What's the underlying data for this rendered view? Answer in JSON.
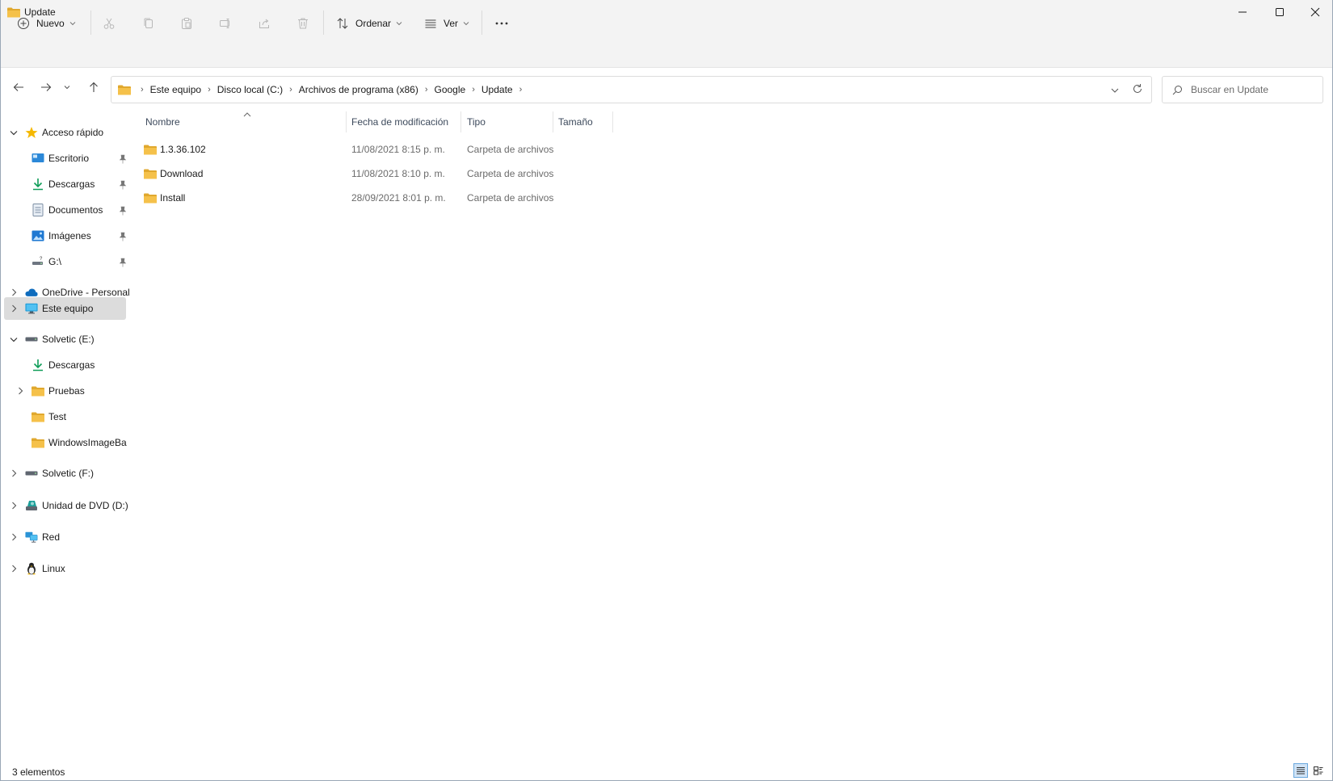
{
  "window": {
    "title": "Update",
    "controls": [
      "minimize",
      "maximize",
      "close"
    ]
  },
  "toolbar": {
    "new_label": "Nuevo",
    "sort_label": "Ordenar",
    "view_label": "Ver",
    "icons": [
      "cut-icon",
      "copy-icon",
      "paste-icon",
      "rename-icon",
      "share-icon",
      "delete-icon"
    ]
  },
  "address": {
    "crumbs": [
      "Este equipo",
      "Disco local (C:)",
      "Archivos de programa (x86)",
      "Google",
      "Update"
    ]
  },
  "search": {
    "placeholder": "Buscar en Update"
  },
  "nav": {
    "quick_access": "Acceso rápido",
    "quick_items": [
      "Escritorio",
      "Descargas",
      "Documentos",
      "Imágenes",
      "G:\\"
    ],
    "onedrive": "OneDrive - Personal",
    "this_pc": "Este equipo",
    "drive_e": "Solvetic (E:)",
    "drive_e_items": [
      "Descargas",
      "Pruebas",
      "Test",
      "WindowsImageBa"
    ],
    "drive_f": "Solvetic (F:)",
    "dvd": "Unidad de DVD (D:)",
    "network": "Red",
    "linux": "Linux"
  },
  "columns": {
    "name": "Nombre",
    "modified": "Fecha de modificación",
    "type": "Tipo",
    "size": "Tamaño"
  },
  "files": [
    {
      "name": "1.3.36.102",
      "modified": "11/08/2021 8:15 p. m.",
      "type": "Carpeta de archivos",
      "size": ""
    },
    {
      "name": "Download",
      "modified": "11/08/2021 8:10 p. m.",
      "type": "Carpeta de archivos",
      "size": ""
    },
    {
      "name": "Install",
      "modified": "28/09/2021 8:01 p. m.",
      "type": "Carpeta de archivos",
      "size": ""
    }
  ],
  "status": {
    "count": "3 elementos"
  },
  "colors": {
    "folder": "#F5C14A",
    "folder_dark": "#E0A82E",
    "accent": "#0067C0",
    "selection": "#DCDCDC"
  }
}
